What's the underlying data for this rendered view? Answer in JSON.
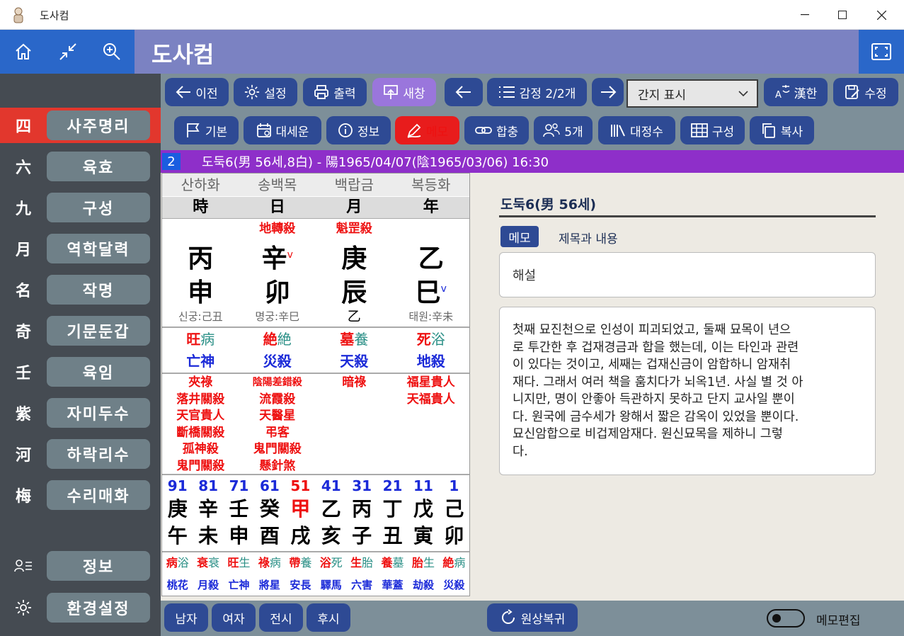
{
  "window": {
    "title": "도사컴"
  },
  "header": {
    "app_title": "도사컴"
  },
  "sidebar": {
    "items": [
      {
        "hanja": "四",
        "label": "사주명리"
      },
      {
        "hanja": "六",
        "label": "육효"
      },
      {
        "hanja": "九",
        "label": "구성"
      },
      {
        "hanja": "月",
        "label": "역학달력"
      },
      {
        "hanja": "名",
        "label": "작명"
      },
      {
        "hanja": "奇",
        "label": "기문둔갑"
      },
      {
        "hanja": "壬",
        "label": "육임"
      },
      {
        "hanja": "紫",
        "label": "자미두수"
      },
      {
        "hanja": "河",
        "label": "하락리수"
      },
      {
        "hanja": "梅",
        "label": "수리매화"
      }
    ],
    "info_label": "정보",
    "settings_label": "환경설정"
  },
  "toolbar1": {
    "prev": "이전",
    "settings": "설정",
    "print": "출력",
    "new_window": "새창",
    "review": "감정 2/2개",
    "combo": "간지 표시",
    "hanja": "漢한",
    "edit": "수정"
  },
  "toolbar2": {
    "basic": "기본",
    "luck": "대세운",
    "info": "정보",
    "memo": "메모",
    "combine": "합충",
    "five": "5개",
    "daejeong": "대정수",
    "structure": "구성",
    "copy": "복사"
  },
  "infobar": {
    "num": "2",
    "text": "도둑6(男 56세,8白) - 陽1965/04/07(陰1965/03/06) 16:30"
  },
  "chart": {
    "nayin": [
      "산하화",
      "송백목",
      "백랍금",
      "복등화"
    ],
    "pillars": [
      "時",
      "日",
      "月",
      "年"
    ],
    "special": [
      "",
      "地轉殺",
      "魁罡殺",
      ""
    ],
    "stems": [
      "丙",
      "辛",
      "庚",
      "乙"
    ],
    "stem_marks": [
      "",
      "v",
      "",
      ""
    ],
    "branches": [
      "申",
      "卯",
      "辰",
      "巳"
    ],
    "branch_marks": [
      "",
      "",
      "",
      "v"
    ],
    "palaces": [
      "신궁:己丑",
      "명궁:辛巳",
      "乙",
      "태원:辛未"
    ],
    "state1_red": [
      "旺",
      "絶",
      "墓",
      "死"
    ],
    "state1_teal": [
      "病",
      "絶",
      "養",
      "浴"
    ],
    "state2": [
      "亡神",
      "災殺",
      "天殺",
      "地殺"
    ],
    "spirits": [
      [
        "夾祿",
        "落井關殺",
        "天官貴人",
        "斷橋關殺",
        "孤神殺",
        "鬼門關殺"
      ],
      [
        "陰陽差錯殺",
        "流霞殺",
        "天醫星",
        "弔客",
        "鬼門關殺",
        "懸針煞"
      ],
      [
        "暗祿"
      ],
      [
        "福星貴人",
        "天福貴人"
      ]
    ],
    "luck_ages": [
      "91",
      "81",
      "71",
      "61",
      "51",
      "41",
      "31",
      "21",
      "11",
      "1"
    ],
    "luck_stems": [
      "庚",
      "辛",
      "壬",
      "癸",
      "甲",
      "乙",
      "丙",
      "丁",
      "戊",
      "己"
    ],
    "luck_branches": [
      "午",
      "未",
      "申",
      "酉",
      "戌",
      "亥",
      "子",
      "丑",
      "寅",
      "卯"
    ],
    "luck_s1": [
      "病",
      "衰",
      "旺",
      "祿",
      "帶",
      "浴",
      "生",
      "養",
      "胎",
      "絶"
    ],
    "luck_s2": [
      "浴",
      "衰",
      "生",
      "病",
      "養",
      "死",
      "胎",
      "墓",
      "生",
      "病"
    ],
    "luck_spirits": [
      "桃花",
      "月殺",
      "亡神",
      "將星",
      "安長",
      "驛馬",
      "六害",
      "華蓋",
      "劫殺",
      "災殺"
    ]
  },
  "bottom": {
    "male": "남자",
    "female": "여자",
    "before": "전시",
    "after": "후시",
    "reset": "원상복귀",
    "memo_edit": "메모편집"
  },
  "memo": {
    "title": "도둑6(男 56세)",
    "tag": "메모",
    "subtitle": "제목과 내용",
    "box_title": "해설",
    "lines": [
      "첫째 묘진천으로 인성이 피괴되었고, 둘째 묘목이 년으",
      "로 투간한 후 겁재경금과 합을 했는데, 이는 타인과 관련",
      "이 있다는 것이고, 세째는 겁재신금이 암합하니 암재취",
      "재다. 그래서 여러 책을 훔치다가 뇌옥1년. 사실 별 것 아",
      "니지만, 명이 안좋아 득관하지 못하고 단지 교사일 뿐이",
      "다. 원국에 금수세가 왕해서 짧은 감옥이 있었을 뿐이다.",
      "묘신암합으로 비겁제암재다. 원신묘목을 제하니 그렇",
      "다."
    ]
  }
}
